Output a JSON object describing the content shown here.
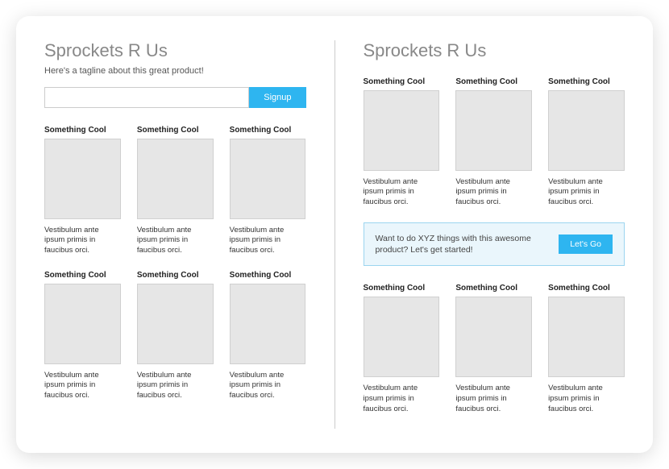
{
  "left": {
    "title": "Sprockets R Us",
    "tagline": "Here's a tagline about this great product!",
    "signup_button": "Signup",
    "row1": [
      {
        "title": "Something Cool",
        "desc": "Vestibulum ante ipsum primis in faucibus orci."
      },
      {
        "title": "Something Cool",
        "desc": "Vestibulum ante ipsum primis in faucibus orci."
      },
      {
        "title": "Something Cool",
        "desc": "Vestibulum ante ipsum primis in faucibus orci."
      }
    ],
    "row2": [
      {
        "title": "Something Cool",
        "desc": "Vestibulum ante ipsum primis in faucibus orci."
      },
      {
        "title": "Something Cool",
        "desc": "Vestibulum ante ipsum primis in faucibus orci."
      },
      {
        "title": "Something Cool",
        "desc": "Vestibulum ante ipsum primis in faucibus orci."
      }
    ]
  },
  "right": {
    "title": "Sprockets R Us",
    "row1": [
      {
        "title": "Something Cool",
        "desc": "Vestibulum ante ipsum primis in faucibus orci."
      },
      {
        "title": "Something Cool",
        "desc": "Vestibulum ante ipsum primis in faucibus orci."
      },
      {
        "title": "Something Cool",
        "desc": "Vestibulum ante ipsum primis in faucibus orci."
      }
    ],
    "cta": {
      "text": "Want to do XYZ things with this awesome product? Let's get started!",
      "button": "Let's Go"
    },
    "row2": [
      {
        "title": "Something Cool",
        "desc": "Vestibulum ante ipsum primis in faucibus orci."
      },
      {
        "title": "Something Cool",
        "desc": "Vestibulum ante ipsum primis in faucibus orci."
      },
      {
        "title": "Something Cool",
        "desc": "Vestibulum ante ipsum primis in faucibus orci."
      }
    ]
  }
}
